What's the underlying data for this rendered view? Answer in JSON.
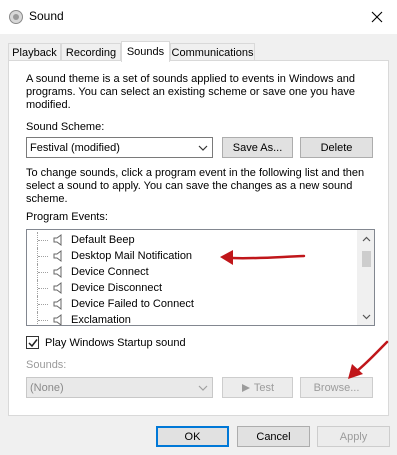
{
  "window": {
    "title": "Sound",
    "app_icon": "speaker-app-icon",
    "close_icon": "close-icon"
  },
  "tabs": [
    {
      "label": "Playback",
      "active": false
    },
    {
      "label": "Recording",
      "active": false
    },
    {
      "label": "Sounds",
      "active": true
    },
    {
      "label": "Communications",
      "active": false
    }
  ],
  "sounds": {
    "description": "A sound theme is a set of sounds applied to events in Windows and programs.  You can select an existing scheme or save one you have modified.",
    "scheme_label": "Sound Scheme:",
    "scheme_value": "Festival (modified)",
    "save_as_label": "Save As...",
    "delete_label": "Delete",
    "instructions": "To change sounds, click a program event in the following list and then select a sound to apply.  You can save the changes as a new sound scheme.",
    "events_label": "Program Events:",
    "events": [
      {
        "label": "Default Beep"
      },
      {
        "label": "Desktop Mail Notification"
      },
      {
        "label": "Device Connect"
      },
      {
        "label": "Device Disconnect"
      },
      {
        "label": "Device Failed to Connect"
      },
      {
        "label": "Exclamation"
      }
    ],
    "startup_checkbox_label": "Play Windows Startup sound",
    "startup_checked": true,
    "sounds_label": "Sounds:",
    "sounds_value": "(None)",
    "test_label": "Test",
    "browse_label": "Browse..."
  },
  "footer": {
    "ok_label": "OK",
    "cancel_label": "Cancel",
    "apply_label": "Apply"
  },
  "colors": {
    "annotation_arrow": "#c0161a",
    "accent": "#0078d7"
  }
}
